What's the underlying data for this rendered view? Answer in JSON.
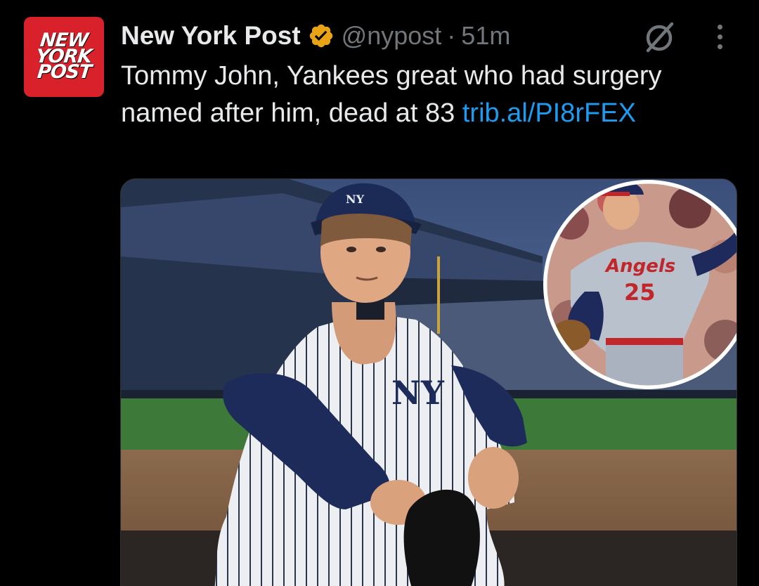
{
  "author": {
    "avatar_text": [
      "NEW",
      "YORK",
      "POST"
    ],
    "name": "New York Post",
    "handle": "@nypost",
    "separator": "·",
    "time": "51m",
    "verified_icon": "verified-badge-icon",
    "verified_color": "#f4b400"
  },
  "tweet": {
    "text": "Tommy John, Yankees great who had surgery named after him, dead at 83 ",
    "link_text": "trib.al/PI8rFEX",
    "link_color": "#1d9bf0"
  },
  "media": {
    "inset_jersey_text": "Angels",
    "inset_jersey_number": "25",
    "cap_logo": "NY"
  },
  "icons": {
    "grok": "grok-icon",
    "more": "more-options-icon"
  }
}
